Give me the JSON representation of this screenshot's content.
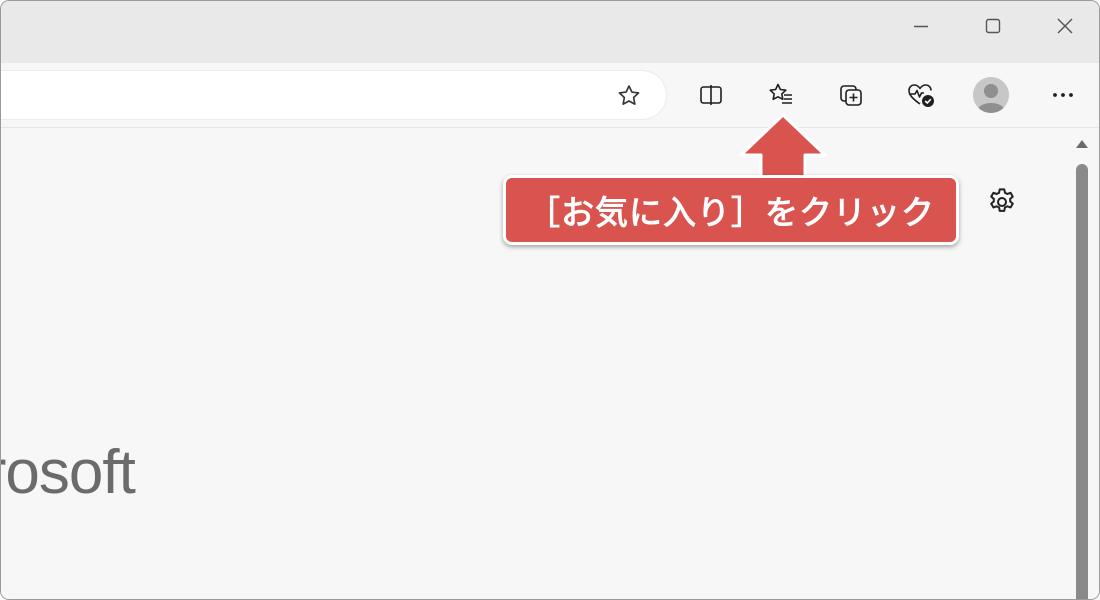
{
  "window_controls": {
    "minimize_icon": "minimize-icon",
    "maximize_icon": "maximize-icon",
    "close_icon": "close-icon"
  },
  "toolbar": {
    "address_favorite_icon": "star-outline-icon",
    "items": [
      {
        "name": "split-screen",
        "icon": "split-screen-icon"
      },
      {
        "name": "favorites",
        "icon": "star-list-icon"
      },
      {
        "name": "collections",
        "icon": "collections-icon"
      },
      {
        "name": "browser-essentials",
        "icon": "heartbeat-check-icon"
      },
      {
        "name": "profile",
        "icon": "avatar-icon"
      },
      {
        "name": "settings-and-more",
        "icon": "more-horizontal-icon"
      }
    ]
  },
  "content": {
    "settings_icon": "gear-icon",
    "brand_text": "icrosoft"
  },
  "callout": {
    "text": "［お気に入り］をクリック",
    "color": "#d9534f"
  },
  "colors": {
    "titlebar": "#e9e9e9",
    "toolbar": "#f7f7f7",
    "accent_callout": "#d9534f",
    "icon": "#1f1f1f"
  }
}
